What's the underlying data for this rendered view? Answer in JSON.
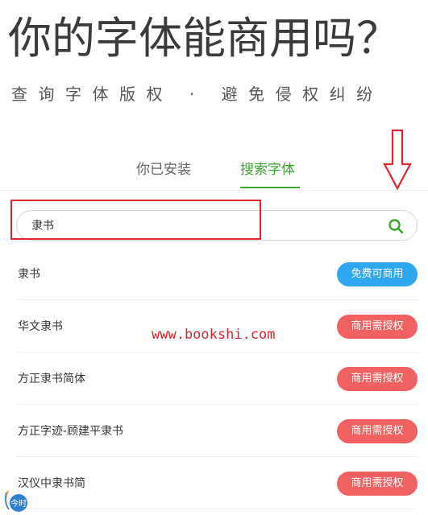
{
  "header": {
    "title": "你的字体能商用吗？",
    "subtitle": "查询字体版权 · 避免侵权纠纷"
  },
  "tabs": [
    {
      "label": "你已安装",
      "active": false
    },
    {
      "label": "搜索字体",
      "active": true
    }
  ],
  "search": {
    "value": "隶书",
    "icon": "search-icon"
  },
  "results": [
    {
      "name": "隶书",
      "status": "免费可商用",
      "status_type": "free"
    },
    {
      "name": "华文隶书",
      "status": "商用需授权",
      "status_type": "paid"
    },
    {
      "name": "方正隶书简体",
      "status": "商用需授权",
      "status_type": "paid"
    },
    {
      "name": "方正字迹-顾建平隶书",
      "status": "商用需授权",
      "status_type": "paid"
    },
    {
      "name": "汉仪中隶书简",
      "status": "商用需授权",
      "status_type": "paid"
    }
  ],
  "overlay": {
    "watermark": "www.bookshi.com",
    "logo_text": "今时"
  },
  "colors": {
    "accent": "#3aa52f",
    "free": "#2fa7ef",
    "paid": "#f06262",
    "annotation": "#e0262e"
  }
}
